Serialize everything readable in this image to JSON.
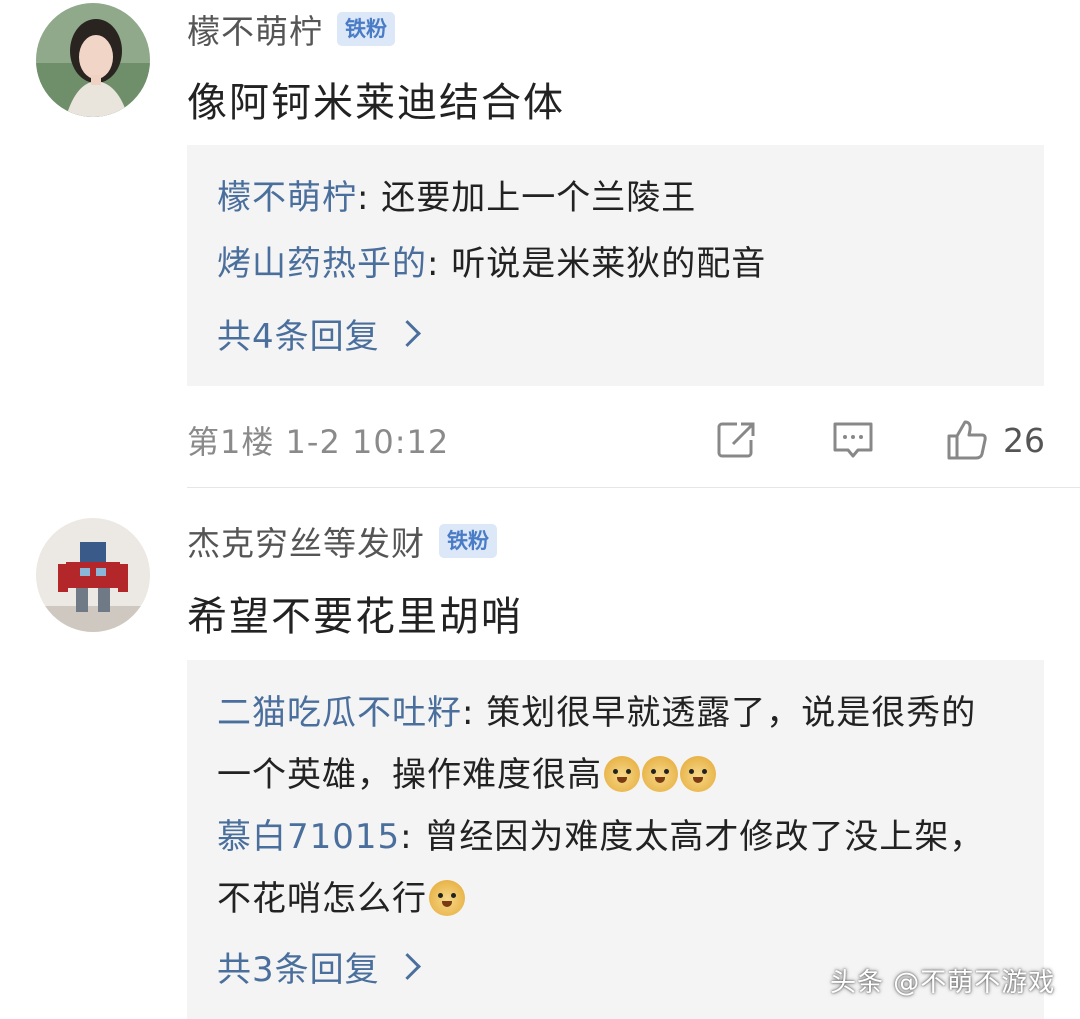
{
  "comments": [
    {
      "username": "檬不萌柠",
      "badge": "铁粉",
      "body": "像阿钶米莱迪结合体",
      "replies": [
        {
          "author": "檬不萌柠",
          "text": ": 还要加上一个兰陵王"
        },
        {
          "author": "烤山药热乎的",
          "text": ": 听说是米莱狄的配音"
        }
      ],
      "more_replies": "共4条回复",
      "floor_time": "第1楼  1-2 10:12",
      "likes": "26"
    },
    {
      "username": "杰克穷丝等发财",
      "badge": "铁粉",
      "body": "希望不要花里胡哨",
      "replies": [
        {
          "author": "二猫吃瓜不吐籽",
          "text": ": 策划很早就透露了，说是很秀的一个英雄，操作难度很高"
        },
        {
          "author": "慕白71015",
          "text": ": 曾经因为难度太高才修改了没上架，不花哨怎么行"
        }
      ],
      "more_replies": "共3条回复"
    }
  ],
  "icons": {
    "share": "share-icon",
    "comment": "comment-icon",
    "like": "thumbs-up-icon",
    "emoji": "doge-emoji-icon"
  },
  "watermark": "头条 @不萌不游戏",
  "colors": {
    "author_blue": "#4a6f9c",
    "badge_bg": "#dce8f8",
    "reply_bg": "#f4f4f4"
  }
}
